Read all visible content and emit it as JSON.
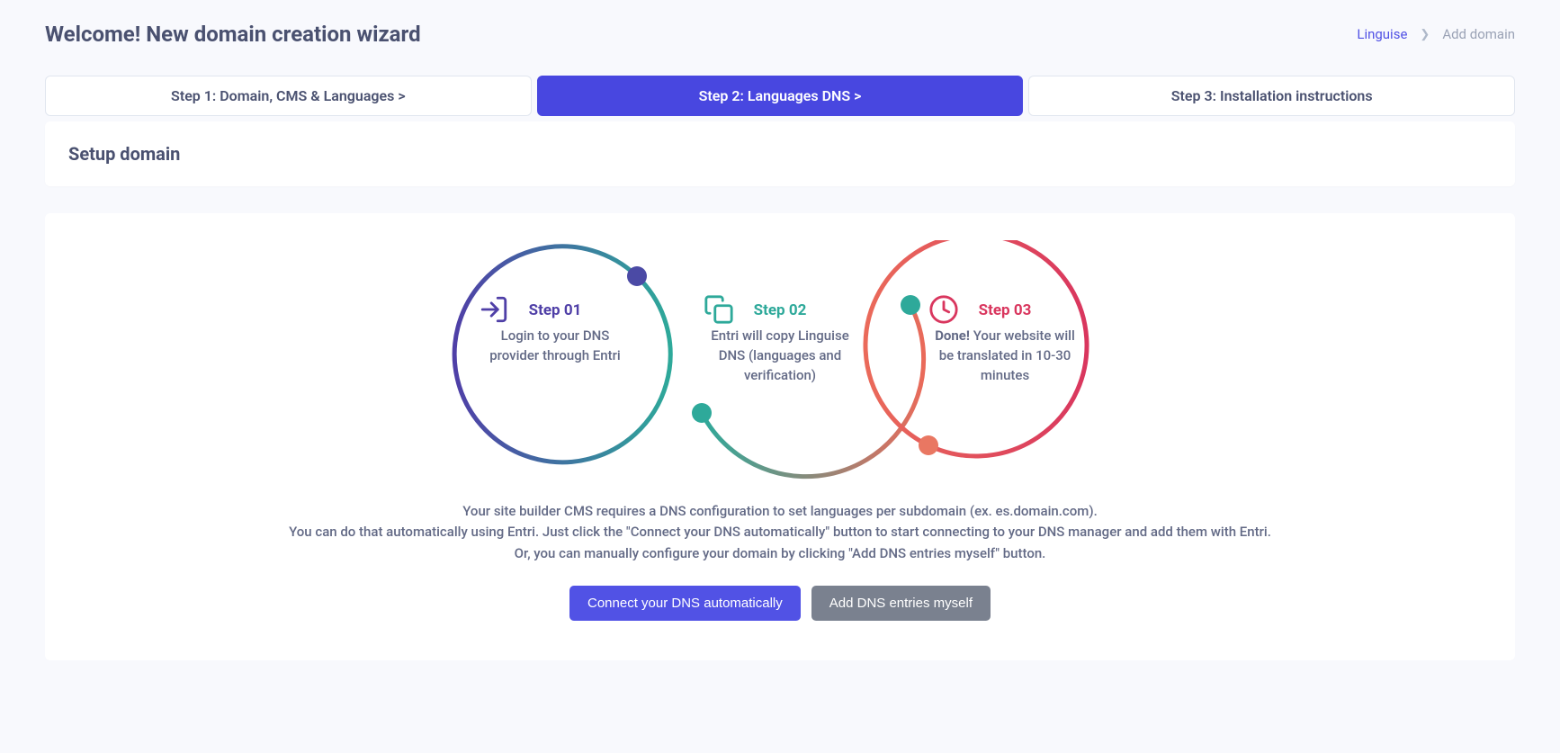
{
  "header": {
    "title": "Welcome! New domain creation wizard",
    "breadcrumb": {
      "link": "Linguise",
      "current": "Add domain"
    }
  },
  "tabs": {
    "t1": "Step 1: Domain, CMS & Languages  >",
    "t2": "Step 2: Languages DNS  >",
    "t3": "Step 3: Installation instructions"
  },
  "panel": {
    "title": "Setup domain"
  },
  "steps": {
    "s1": {
      "title": "Step 01",
      "desc": "Login to your DNS provider through Entri"
    },
    "s2": {
      "title": "Step 02",
      "desc": "Entri will copy Linguise DNS (languages and verification)"
    },
    "s3": {
      "title": "Step 03",
      "desc_strong": "Done!",
      "desc": " Your website will be translated in 10-30 minutes"
    }
  },
  "info": {
    "line1": "Your site builder CMS requires a DNS configuration to set languages per subdomain (ex. es.domain.com).",
    "line2": "You can do that automatically using Entri. Just click the \"Connect your DNS automatically\" button to start connecting to your DNS manager and add them with Entri.",
    "line3": "Or, you can manually configure your domain by clicking \"Add DNS entries myself\" button."
  },
  "buttons": {
    "primary": "Connect your DNS automatically",
    "secondary": "Add DNS entries myself"
  }
}
